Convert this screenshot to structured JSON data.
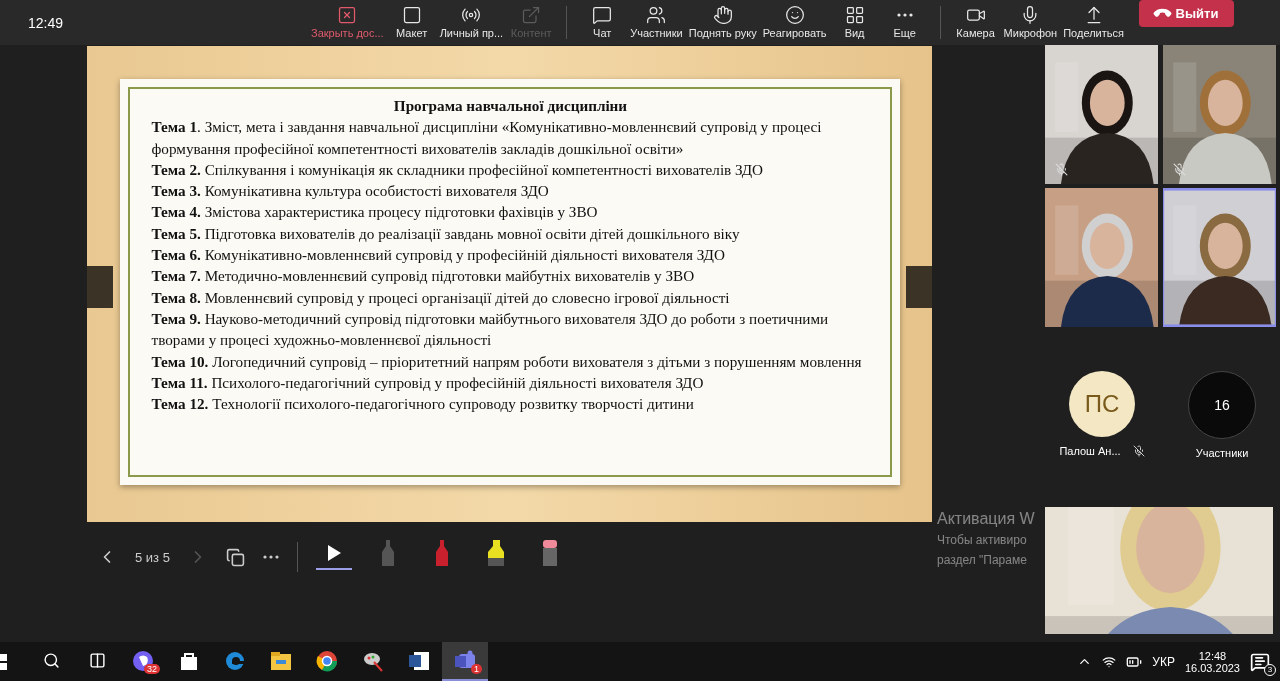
{
  "clock": "12:49",
  "toolbar": {
    "groups": [
      [
        {
          "label": "Закрыть дос...",
          "active": true,
          "disabled": false
        },
        {
          "label": "Макет",
          "active": false,
          "disabled": false
        },
        {
          "label": "Личный пр...",
          "active": false,
          "disabled": false
        },
        {
          "label": "Контент",
          "active": false,
          "disabled": true
        }
      ],
      [
        {
          "label": "Чат",
          "active": false,
          "disabled": false
        },
        {
          "label": "Участники",
          "active": false,
          "disabled": false
        },
        {
          "label": "Поднять руку",
          "active": false,
          "disabled": false
        },
        {
          "label": "Реагировать",
          "active": false,
          "disabled": false
        },
        {
          "label": "Вид",
          "active": false,
          "disabled": false
        },
        {
          "label": "Еще",
          "active": false,
          "disabled": false
        }
      ],
      [
        {
          "label": "Камера",
          "active": false,
          "disabled": false
        },
        {
          "label": "Микрофон",
          "active": false,
          "disabled": false
        },
        {
          "label": "Поделиться",
          "active": false,
          "disabled": false
        }
      ]
    ],
    "leave_button": "Выйти"
  },
  "slide": {
    "title": "Програма навчальної дисципліни",
    "topics": [
      "**Тема 1**. Зміст, мета і завдання навчальної дисципліни «Комунікативно-мовленнєвий супровід у процесі формування професійної компетентності вихователів закладів дошкільної освіти»",
      "**Тема 2.** Спілкування і комунікація як складники професійної компетентності вихователів ЗДО",
      "**Тема 3.** Комунікативна культура особистості вихователя ЗДО",
      "**Тема 4.** Змістова характеристика процесу підготовки фахівців у ЗВО",
      "**Тема 5.** Підготовка вихователів до реалізації завдань мовної освіти дітей дошкільного віку",
      "**Тема 6.** Комунікативно-мовленнєвий супровід у професійній діяльності вихователя ЗДО",
      "**Тема 7.** Методично-мовленнєвий супровід підготовки майбутніх вихователів у ЗВО",
      "**Тема 8.** Мовленнєвий супровід у процесі організації дітей до словесно ігрової діяльності",
      "**Тема 9.** Науково-методичний супровід підготовки майбутнього вихователя ЗДО до роботи з поетичними творами у процесі художньо-мовленнєвої діяльності",
      "**Тема 10.** Логопедичний супровід – пріоритетний напрям роботи вихователя з дітьми з порушенням мовлення",
      "**Тема 11.** Психолого-педагогічний супровід у професійній діяльності вихователя ЗДО",
      "**Тема 12.** Технології психолого-педагогічного супроводу розвитку творчості дитини"
    ]
  },
  "slide_controls": {
    "page": "5 из 5",
    "prev_disabled": false,
    "next_disabled": true,
    "tools": [
      {
        "kind": "pointer",
        "selected": true,
        "color": "#ffffff"
      },
      {
        "kind": "pen",
        "selected": false,
        "color": "#555555"
      },
      {
        "kind": "pen",
        "selected": false,
        "color": "#c8202c"
      },
      {
        "kind": "highlighter",
        "selected": false,
        "color": "#e8e020"
      },
      {
        "kind": "eraser",
        "selected": false,
        "color": "#f08a9a"
      }
    ]
  },
  "video_tiles": [
    {
      "kind": "picture",
      "muted": true,
      "speaking": false
    },
    {
      "kind": "picture",
      "muted": true,
      "speaking": false
    },
    {
      "kind": "picture",
      "muted": false,
      "speaking": false
    },
    {
      "kind": "picture",
      "muted": false,
      "speaking": true
    }
  ],
  "participants": [
    {
      "initials": "ПС",
      "name": "Палош Ан...",
      "muted": true
    },
    {
      "count": "16",
      "label": "Участники"
    }
  ],
  "self_view": {
    "kind": "picture"
  },
  "activation_notice": {
    "title": "Активация W",
    "line_1": "Чтобы активиро",
    "line_2": "раздел \"Параме"
  },
  "taskbar": {
    "apps": [
      {
        "badge": "32",
        "selected": false
      },
      {
        "selected": false
      },
      {
        "selected": false
      },
      {
        "selected": false
      },
      {
        "selected": false
      },
      {
        "selected": false
      },
      {
        "selected": false
      },
      {
        "badge": "1",
        "selected": true
      }
    ],
    "language": "УКР",
    "time": "12:48",
    "date": "16.03.2023",
    "notifications": "3"
  }
}
